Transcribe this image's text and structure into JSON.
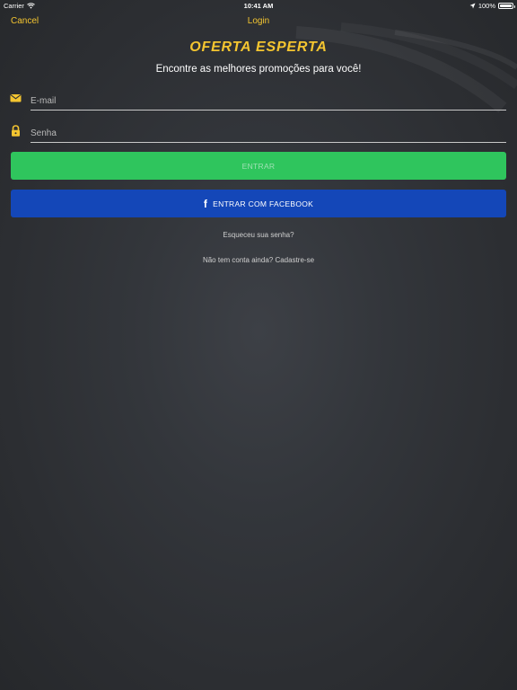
{
  "status_bar": {
    "carrier": "Carrier",
    "time": "10:41 AM",
    "battery": "100%",
    "battery_level": 1.0
  },
  "nav": {
    "cancel_label": "Cancel",
    "title": "Login"
  },
  "brand": {
    "name": "OFERTA ESPERTA",
    "tagline": "Encontre as melhores promoções para você!"
  },
  "form": {
    "email_placeholder": "E-mail",
    "email_value": "",
    "email_icon": "envelope-icon",
    "password_placeholder": "Senha",
    "password_value": "",
    "password_icon": "lock-icon"
  },
  "buttons": {
    "login_label": "ENTRAR",
    "facebook_label": "ENTRAR COM FACEBOOK",
    "facebook_icon": "f"
  },
  "links": {
    "forgot_password": "Esqueceu sua senha?",
    "signup": "Não tem conta ainda? Cadastre-se"
  },
  "colors": {
    "accent": "#f4c530",
    "login_button": "#2fc55d",
    "facebook_button": "#1447b8",
    "background": "#33363b"
  }
}
